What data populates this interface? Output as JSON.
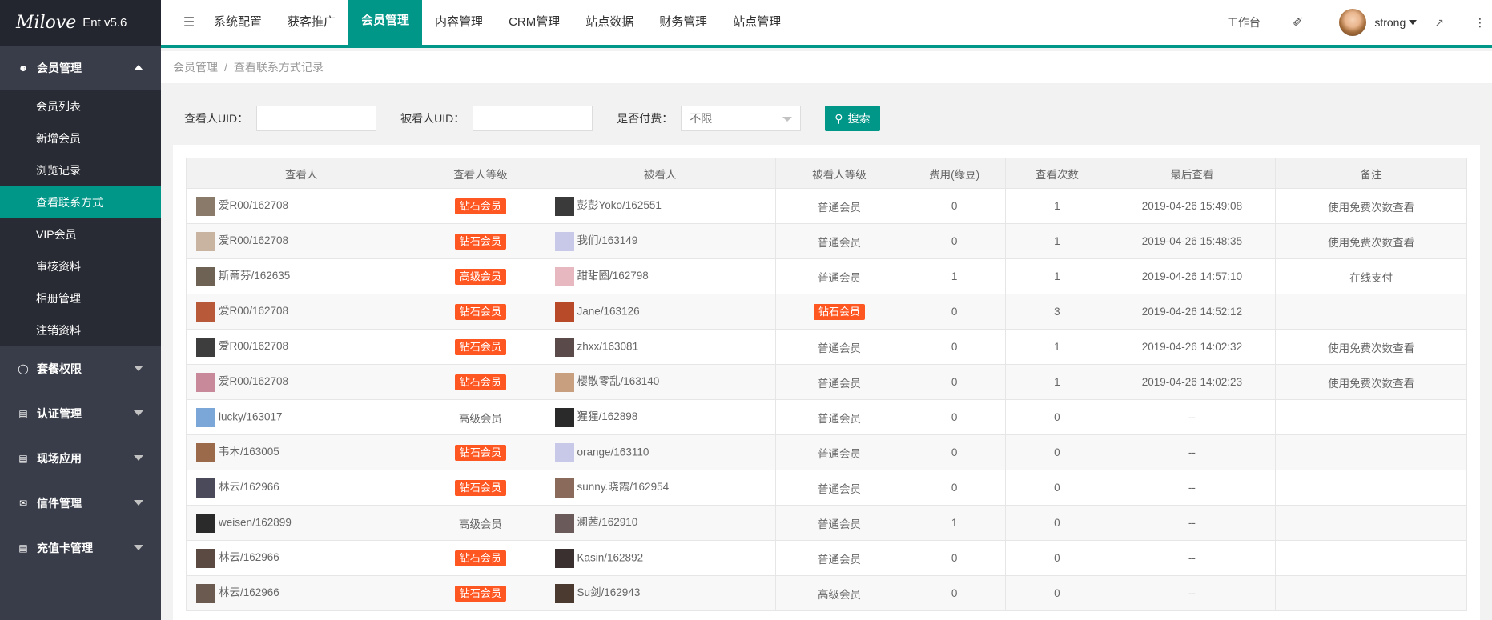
{
  "app": {
    "logo_mark": "Milove",
    "logo_version": "Ent v5.6"
  },
  "sidebar": {
    "groups": [
      {
        "label": "会员管理",
        "icon": "user-icon",
        "expanded": true
      },
      {
        "label": "套餐权限",
        "icon": "shield-icon"
      },
      {
        "label": "认证管理",
        "icon": "id-card-icon"
      },
      {
        "label": "现场应用",
        "icon": "picture-icon"
      },
      {
        "label": "信件管理",
        "icon": "mail-icon"
      },
      {
        "label": "充值卡管理",
        "icon": "card-icon"
      }
    ],
    "items": [
      "会员列表",
      "新增会员",
      "浏览记录",
      "查看联系方式",
      "VIP会员",
      "审核资料",
      "相册管理",
      "注销资料"
    ],
    "active_item": "查看联系方式"
  },
  "topbar": {
    "tabs": [
      "系统配置",
      "获客推广",
      "会员管理",
      "内容管理",
      "CRM管理",
      "站点数据",
      "财务管理",
      "站点管理"
    ],
    "active_tab": "会员管理",
    "workbench": "工作台",
    "username": "strong"
  },
  "breadcrumb": {
    "root": "会员管理",
    "sep": "/",
    "current": "查看联系方式记录"
  },
  "filter": {
    "viewer_uid_label": "查看人UID：",
    "viewed_uid_label": "被看人UID：",
    "paid_label": "是否付费：",
    "paid_value": "不限",
    "search_label": "搜索"
  },
  "table": {
    "headers": [
      "查看人",
      "查看人等级",
      "被看人",
      "被看人等级",
      "费用(缘豆)",
      "查看次数",
      "最后查看",
      "备注"
    ],
    "rows": [
      {
        "viewer": "爱R00/162708",
        "viewer_level": "钻石会员",
        "viewer_badge": true,
        "viewed": "彭彭Yoko/162551",
        "viewed_level": "普通会员",
        "viewed_badge": false,
        "fee": "0",
        "count": "1",
        "last": "2019-04-26 15:49:08",
        "note": "使用免费次数查看"
      },
      {
        "viewer": "爱R00/162708",
        "viewer_level": "钻石会员",
        "viewer_badge": true,
        "viewed": "我们/163149",
        "viewed_level": "普通会员",
        "viewed_badge": false,
        "fee": "0",
        "count": "1",
        "last": "2019-04-26 15:48:35",
        "note": "使用免费次数查看"
      },
      {
        "viewer": "斯蒂芬/162635",
        "viewer_level": "高级会员",
        "viewer_badge": true,
        "viewed": "甜甜圈/162798",
        "viewed_level": "普通会员",
        "viewed_badge": false,
        "fee": "1",
        "count": "1",
        "last": "2019-04-26 14:57:10",
        "note": "在线支付"
      },
      {
        "viewer": "爱R00/162708",
        "viewer_level": "钻石会员",
        "viewer_badge": true,
        "viewed": "Jane/163126",
        "viewed_level": "钻石会员",
        "viewed_badge": true,
        "fee": "0",
        "count": "3",
        "last": "2019-04-26 14:52:12",
        "note": ""
      },
      {
        "viewer": "爱R00/162708",
        "viewer_level": "钻石会员",
        "viewer_badge": true,
        "viewed": "zhxx/163081",
        "viewed_level": "普通会员",
        "viewed_badge": false,
        "fee": "0",
        "count": "1",
        "last": "2019-04-26 14:02:32",
        "note": "使用免费次数查看"
      },
      {
        "viewer": "爱R00/162708",
        "viewer_level": "钻石会员",
        "viewer_badge": true,
        "viewed": "樱散零乱/163140",
        "viewed_level": "普通会员",
        "viewed_badge": false,
        "fee": "0",
        "count": "1",
        "last": "2019-04-26 14:02:23",
        "note": "使用免费次数查看"
      },
      {
        "viewer": "lucky/163017",
        "viewer_level": "高级会员",
        "viewer_badge": false,
        "viewed": "猩猩/162898",
        "viewed_level": "普通会员",
        "viewed_badge": false,
        "fee": "0",
        "count": "0",
        "last": "--",
        "note": ""
      },
      {
        "viewer": "韦木/163005",
        "viewer_level": "钻石会员",
        "viewer_badge": true,
        "viewed": "orange/163110",
        "viewed_level": "普通会员",
        "viewed_badge": false,
        "fee": "0",
        "count": "0",
        "last": "--",
        "note": ""
      },
      {
        "viewer": "林云/162966",
        "viewer_level": "钻石会员",
        "viewer_badge": true,
        "viewed": "sunny.晓霞/162954",
        "viewed_level": "普通会员",
        "viewed_badge": false,
        "fee": "0",
        "count": "0",
        "last": "--",
        "note": ""
      },
      {
        "viewer": "weisen/162899",
        "viewer_level": "高级会员",
        "viewer_badge": false,
        "viewed": "澜茜/162910",
        "viewed_level": "普通会员",
        "viewed_badge": false,
        "fee": "1",
        "count": "0",
        "last": "--",
        "note": ""
      },
      {
        "viewer": "林云/162966",
        "viewer_level": "钻石会员",
        "viewer_badge": true,
        "viewed": "Kasin/162892",
        "viewed_level": "普通会员",
        "viewed_badge": false,
        "fee": "0",
        "count": "0",
        "last": "--",
        "note": ""
      },
      {
        "viewer": "林云/162966",
        "viewer_level": "钻石会员",
        "viewer_badge": true,
        "viewed": "Su剑/162943",
        "viewed_level": "高级会员",
        "viewed_badge": false,
        "fee": "0",
        "count": "0",
        "last": "--",
        "note": ""
      }
    ]
  },
  "colors": {
    "accent": "#009688",
    "sidebar_bg": "#393d49",
    "badge": "#ff5722"
  }
}
